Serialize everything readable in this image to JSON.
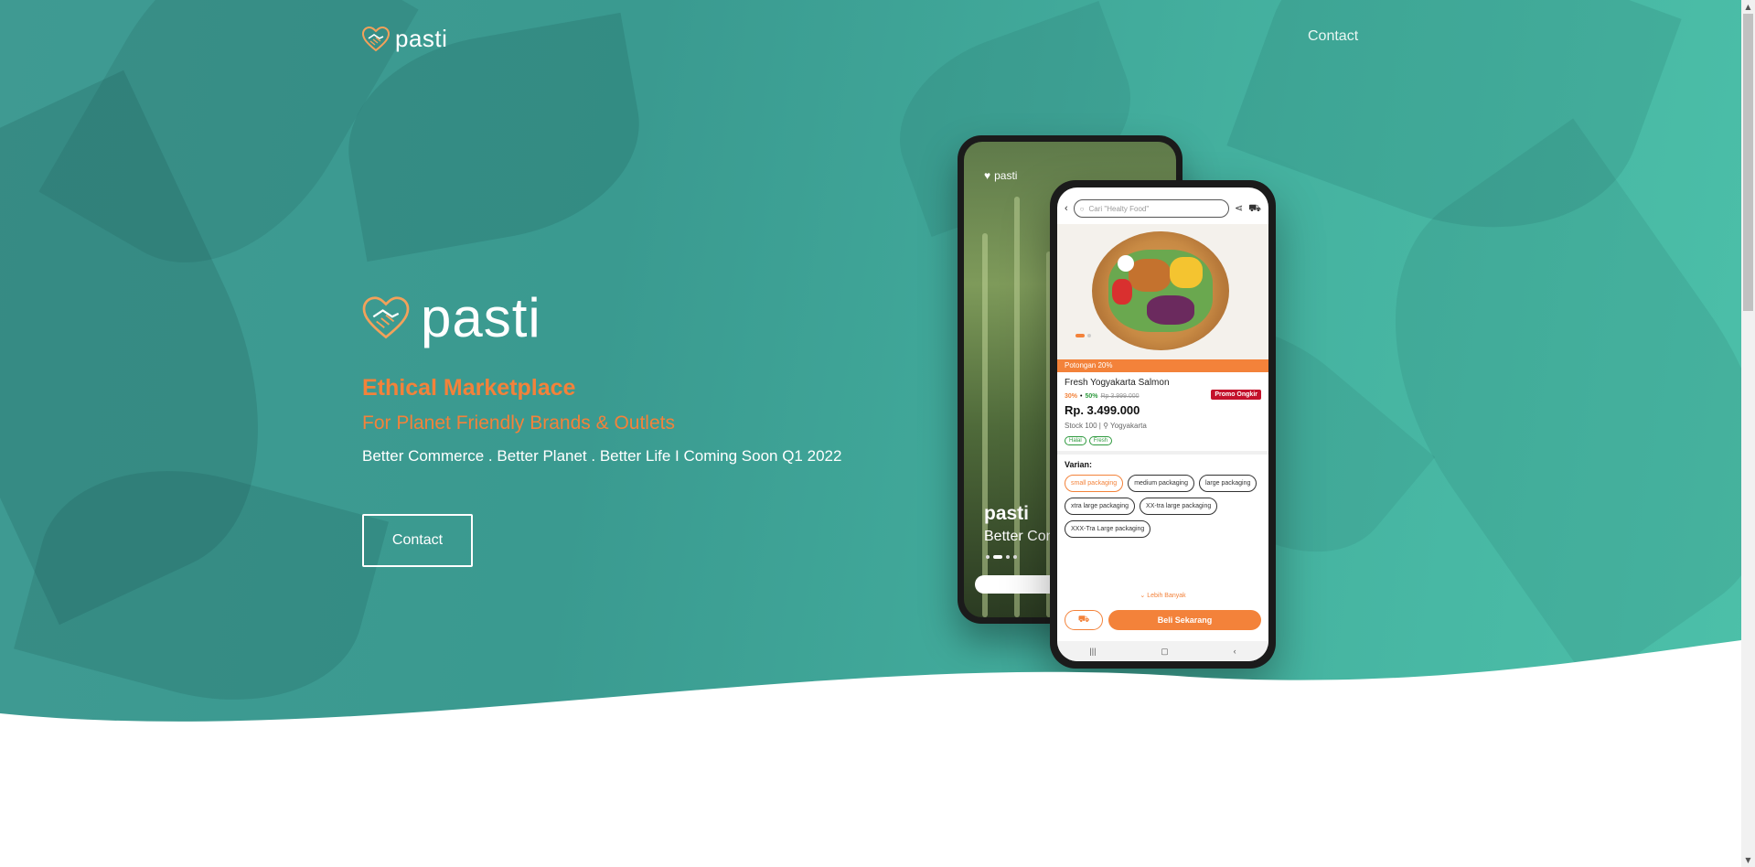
{
  "nav": {
    "logo_text": "pasti",
    "contact_label": "Contact"
  },
  "hero": {
    "brand_text": "pasti",
    "headline": "Ethical Marketplace",
    "subheadline": "For Planet Friendly Brands & Outlets",
    "tagline": "Better Commerce . Better Planet . Better Life I Coming Soon Q1 2022",
    "cta_label": "Contact"
  },
  "phone_back": {
    "logo_text": "pasti",
    "title": "pasti",
    "subtitle": "Better Commerce"
  },
  "phone_front": {
    "search_placeholder": "Cari \"Healty Food\"",
    "promo_bar": "Potongan 20%",
    "product_name": "Fresh Yogyakarta Salmon",
    "discount_1": "30%",
    "discount_sep": "•",
    "discount_2": "50%",
    "old_price": "Rp 3.999.000",
    "badge": "Promo Ongkir",
    "price": "Rp. 3.499.000",
    "stock": "Stock 100 | ⚲ Yogyakarta",
    "tags": [
      "Halal",
      "Fresh"
    ],
    "variant_title": "Varian:",
    "variants": [
      "small packaging",
      "medium packaging",
      "large packaging",
      "xtra large packaging",
      "XX-tra large packaging",
      "XXX-Tra Large packaging"
    ],
    "more_label": "Lebih Banyak",
    "buy_label": "Beli Sekarang"
  },
  "colors": {
    "accent": "#f3823a",
    "hero_teal": "#3f9a92",
    "white": "#ffffff"
  },
  "icons": {
    "logo": "handshake-heart-icon",
    "back": "chevron-left-icon",
    "search": "search-icon",
    "share": "share-icon",
    "cart": "cart-icon"
  }
}
